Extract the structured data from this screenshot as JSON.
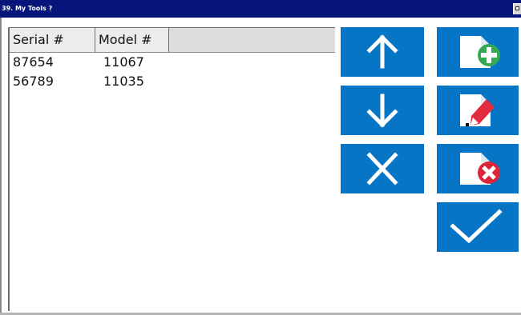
{
  "window": {
    "title": "39. My Tools ?"
  },
  "table": {
    "headers": {
      "serial": "Serial #",
      "model": "Model #"
    },
    "rows": [
      {
        "serial": "87654",
        "model": "11067"
      },
      {
        "serial": "56789",
        "model": "11035"
      }
    ]
  },
  "buttons": [
    {
      "name": "move-up-button",
      "icon": "arrow-up-icon"
    },
    {
      "name": "move-down-button",
      "icon": "arrow-down-icon"
    },
    {
      "name": "clear-button",
      "icon": "x-icon"
    },
    {
      "name": "add-tool-button",
      "icon": "document-plus-icon"
    },
    {
      "name": "edit-tool-button",
      "icon": "document-edit-icon"
    },
    {
      "name": "remove-tool-button",
      "icon": "document-remove-icon"
    },
    {
      "name": "confirm-button",
      "icon": "check-icon"
    }
  ],
  "colors": {
    "titlebar": "#07157b",
    "button_blue": "#0775c6",
    "add_green": "#35a853",
    "edit_red": "#e22b3f",
    "remove_red": "#d9263a"
  }
}
